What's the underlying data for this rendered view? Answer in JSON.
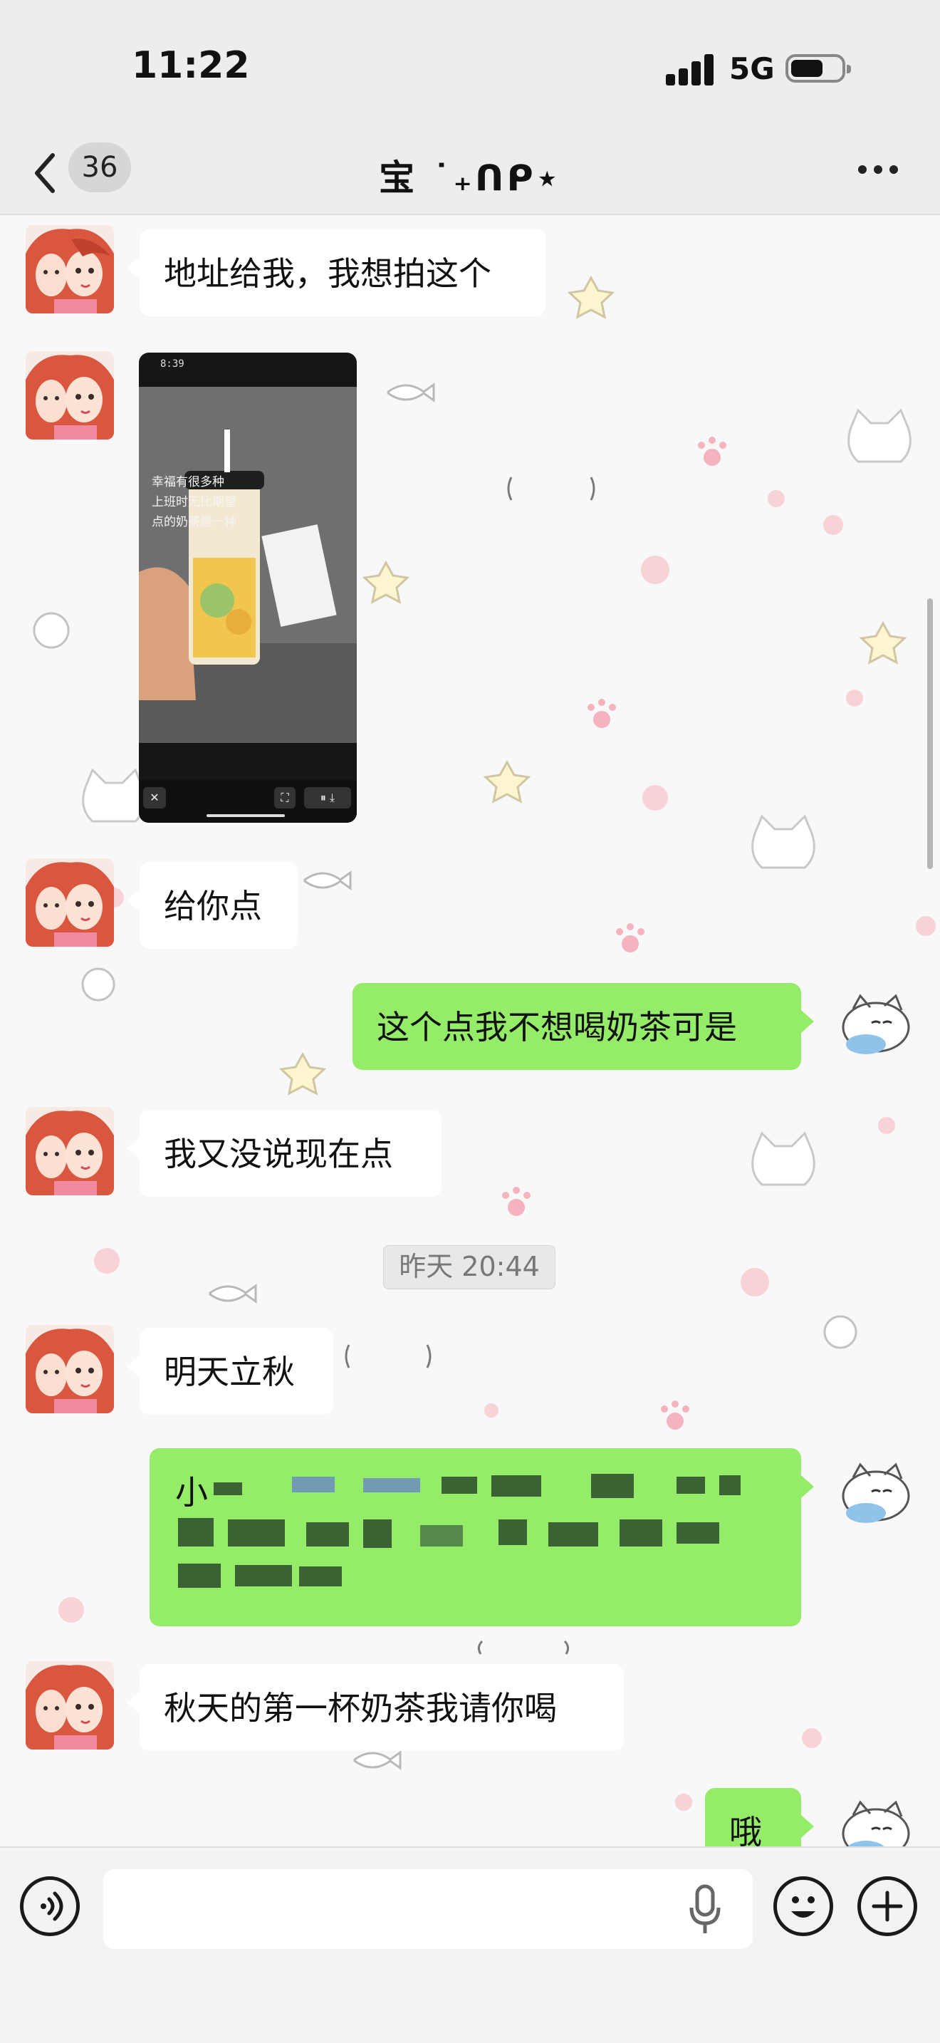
{
  "status_bar": {
    "time": "11:22",
    "network": "5G"
  },
  "nav": {
    "back_count": "36",
    "title": "宝 ˙₊ᑎᑭ⋆"
  },
  "messages": [
    {
      "side": "left",
      "text": "地址给我，我想拍这个"
    },
    {
      "side": "left",
      "type": "photo",
      "photo": {
        "phone_time": "8:39",
        "handwriting": [
          "幸福有很多种",
          "上班时无比期望",
          "点的奶茶是一种"
        ]
      }
    },
    {
      "side": "left",
      "text": "给你点"
    },
    {
      "side": "right",
      "text": "这个点我不想喝奶茶可是"
    },
    {
      "side": "left",
      "text": "我又没说现在点"
    },
    {
      "type": "timestamp",
      "text": "昨天 20:44"
    },
    {
      "side": "left",
      "text": "明天立秋"
    },
    {
      "side": "right",
      "type": "redacted",
      "text": "小"
    },
    {
      "side": "left",
      "text": "秋天的第一杯奶茶我请你喝"
    },
    {
      "side": "right",
      "text": "哦"
    }
  ],
  "input_bar": {
    "placeholder": ""
  },
  "icons": {
    "back": "chevron-left-icon",
    "more": "more-dots-icon",
    "voice": "voice-icon",
    "mic": "microphone-icon",
    "emoji": "emoji-icon",
    "plus": "plus-icon"
  },
  "colors": {
    "my_bubble": "#95ec69",
    "their_bubble": "#ffffff",
    "header_bg": "#ededed"
  }
}
